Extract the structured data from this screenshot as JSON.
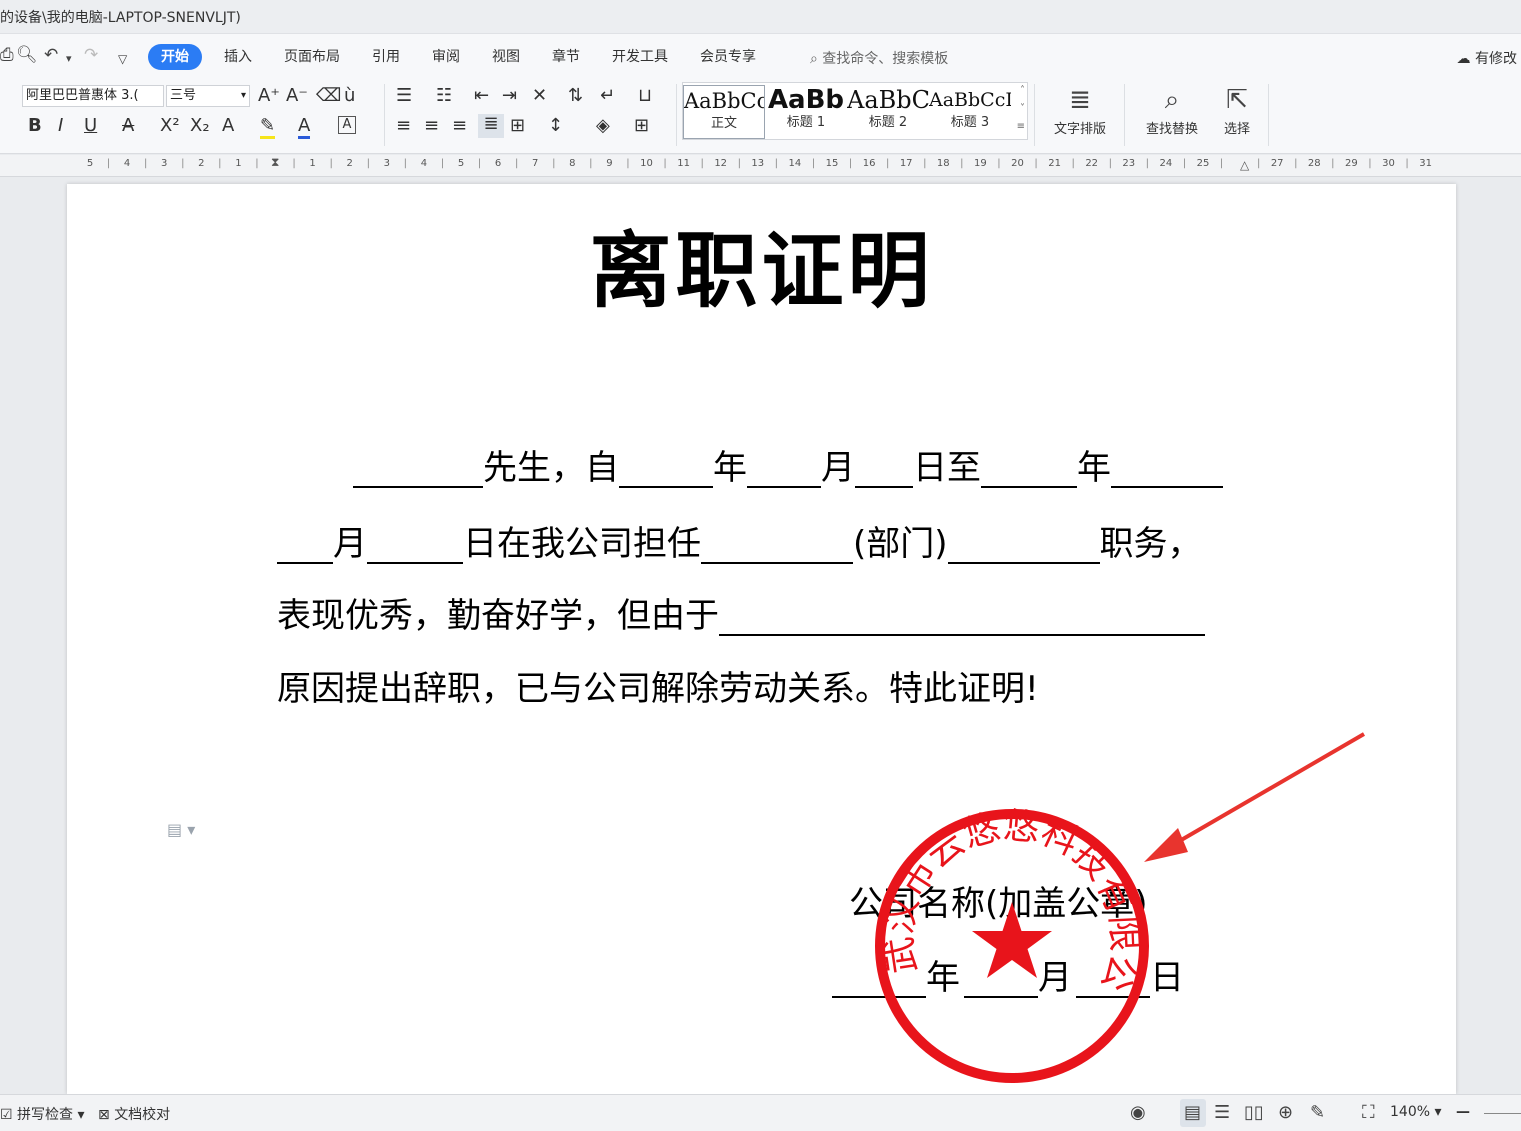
{
  "window": {
    "title_path": "的设备\\我的电脑-LAPTOP-SNENVLJT)"
  },
  "menu": {
    "tabs": [
      "开始",
      "插入",
      "页面布局",
      "引用",
      "审阅",
      "视图",
      "章节",
      "开发工具",
      "会员专享"
    ],
    "active_tab": "开始",
    "search_placeholder": "查找命令、搜索模板",
    "modified_label": "有修改"
  },
  "ribbon": {
    "font_name": "阿里巴巴普惠体 3.(",
    "font_size": "三号",
    "styles": [
      {
        "preview": "AaBbCc",
        "name": "正文"
      },
      {
        "preview": "AaBb",
        "name": "标题 1"
      },
      {
        "preview": "AaBbC",
        "name": "标题 2"
      },
      {
        "preview": "AaBbCcI",
        "name": "标题 3"
      }
    ],
    "text_layout_label": "文字排版",
    "find_replace_label": "查找替换",
    "select_label": "选择"
  },
  "ruler": {
    "ticks": [
      "5",
      "4",
      "3",
      "2",
      "1",
      "",
      "1",
      "2",
      "3",
      "4",
      "5",
      "6",
      "7",
      "8",
      "9",
      "10",
      "11",
      "12",
      "13",
      "14",
      "15",
      "16",
      "17",
      "18",
      "19",
      "20",
      "21",
      "22",
      "23",
      "24",
      "25",
      "",
      "27",
      "28",
      "29",
      "30",
      "31"
    ]
  },
  "document": {
    "title": "离职证明",
    "line1": {
      "a": "先生，自",
      "b": "年",
      "c": "月",
      "d": "日至",
      "e": "年"
    },
    "line2": {
      "a": "月",
      "b": "日在我公司担任",
      "c": "(部门)",
      "d": "职务，"
    },
    "line3": {
      "a": "表现优秀，勤奋好学，但由于"
    },
    "line4": {
      "a": "原因提出辞职，已与公司解除劳动关系。特此证明!"
    },
    "company": "公司名称(加盖公章)",
    "date": {
      "year": "年",
      "month": "月",
      "day": "日"
    },
    "stamp_text": "武汉市云悠悠科技有限公司",
    "stamp_color": "#e8141b",
    "arrow_color": "#e8342e"
  },
  "status": {
    "spell_check": "拼写检查",
    "doc_proof": "文档校对",
    "zoom": "140%"
  }
}
